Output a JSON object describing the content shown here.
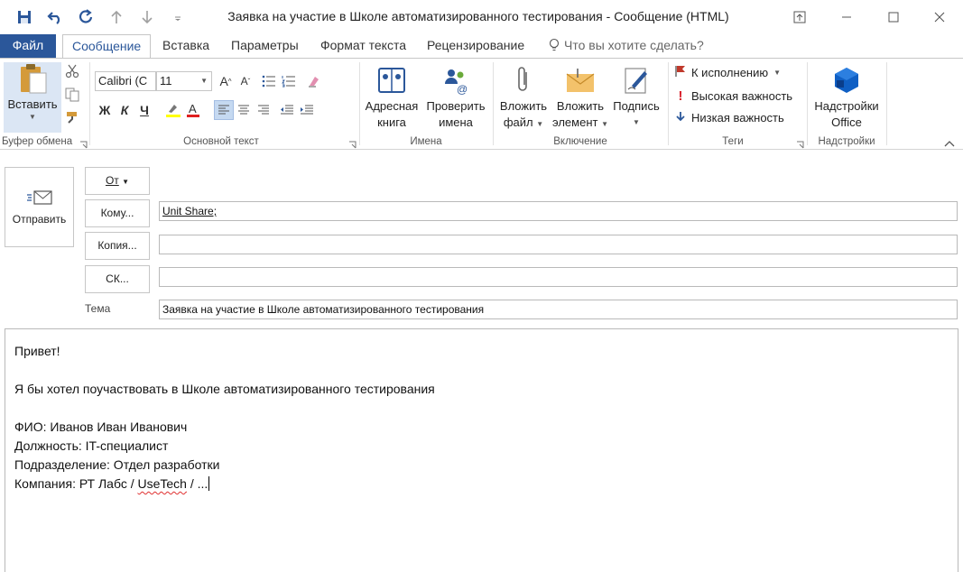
{
  "window": {
    "title": "Заявка на участие в Школе автоматизированного тестирования - Сообщение (HTML)"
  },
  "tabs": {
    "file": "Файл",
    "items": [
      "Сообщение",
      "Вставка",
      "Параметры",
      "Формат текста",
      "Рецензирование"
    ],
    "tell_me": "Что вы хотите сделать?"
  },
  "ribbon": {
    "clipboard": {
      "paste": "Вставить",
      "group": "Буфер обмена"
    },
    "basic_text": {
      "font_name": "Calibri (С",
      "font_size": "11",
      "bold": "Ж",
      "italic": "К",
      "underline": "Ч",
      "group": "Основной текст"
    },
    "names": {
      "address_book": [
        "Адресная",
        "книга"
      ],
      "check_names": [
        "Проверить",
        "имена"
      ],
      "group": "Имена"
    },
    "include": {
      "attach_file": [
        "Вложить",
        "файл"
      ],
      "attach_item": [
        "Вложить",
        "элемент"
      ],
      "signature": "Подпись",
      "group": "Включение"
    },
    "tags": {
      "follow_up": "К исполнению",
      "high": "Высокая важность",
      "low": "Низкая важность",
      "group": "Теги"
    },
    "addins": {
      "office": [
        "Надстройки",
        "Office"
      ],
      "group": "Надстройки"
    }
  },
  "compose": {
    "send": "Отправить",
    "from": "От",
    "to_btn": "Кому...",
    "cc_btn": "Копия...",
    "bcc_btn": "СК...",
    "to_value": "Unit Share;",
    "cc_value": "",
    "bcc_value": "",
    "subject_label": "Тема",
    "subject_value": "Заявка на участие в Школе автоматизированного тестирования"
  },
  "body": {
    "line1": "Привет!",
    "line2": "Я бы хотел поучаствовать в Школе автоматизированного тестирования",
    "line3": "ФИО: Иванов Иван Иванович",
    "line4": "Должность: IT-специалист",
    "line5": "Подразделение: Отдел разработки",
    "line6_a": "Компания: РТ Лабс / ",
    "line6_b": "UseTech",
    "line6_c": " / ..."
  },
  "colors": {
    "accent": "#2b579a",
    "flag": "#c0392b",
    "high_importance": "#d9232e",
    "low_importance": "#2b579a"
  },
  "icons": {
    "qat": [
      "save-icon",
      "undo-icon",
      "redo-icon",
      "up-arrow-icon",
      "down-arrow-icon",
      "customize-qat-icon"
    ],
    "window": [
      "ribbon-display-icon",
      "minimize-icon",
      "maximize-icon",
      "close-icon"
    ]
  }
}
